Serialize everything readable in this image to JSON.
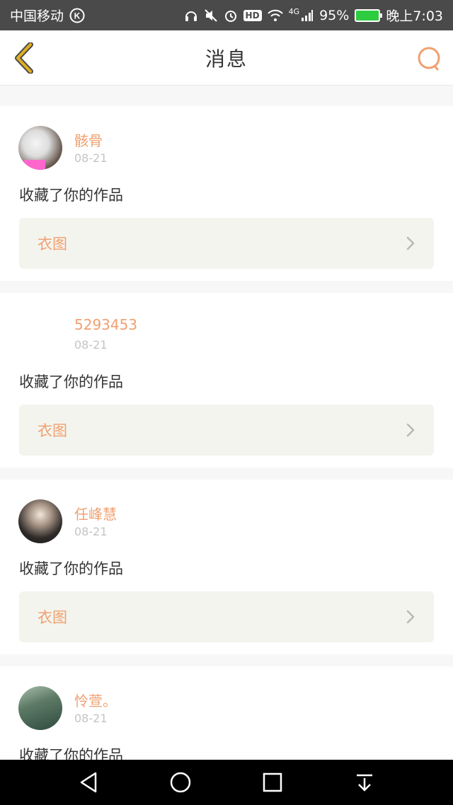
{
  "status_bar": {
    "carrier": "中国移动",
    "network": "4G",
    "battery_percent": "95%",
    "time": "晚上7:03",
    "hd_label": "HD",
    "carrier_badge": "K"
  },
  "nav": {
    "title": "消息",
    "back_icon": "chevron-left-icon",
    "search_icon": "search-icon"
  },
  "messages": [
    {
      "name": "骸骨",
      "date": "08-21",
      "text": "收藏了你的作品",
      "work_title": "衣图"
    },
    {
      "name": "5293453",
      "date": "08-21",
      "text": "收藏了你的作品",
      "work_title": "衣图"
    },
    {
      "name": "任峰慧",
      "date": "08-21",
      "text": "收藏了你的作品",
      "work_title": "衣图"
    },
    {
      "name": "怜萱。",
      "date": "08-21",
      "text": "收藏了你的作品",
      "work_title": ""
    }
  ],
  "colors": {
    "accent": "#f0a070",
    "back_icon": "#e0b020",
    "status_bar_bg": "#4a4a4a",
    "link_bg": "#f4f4ee"
  }
}
